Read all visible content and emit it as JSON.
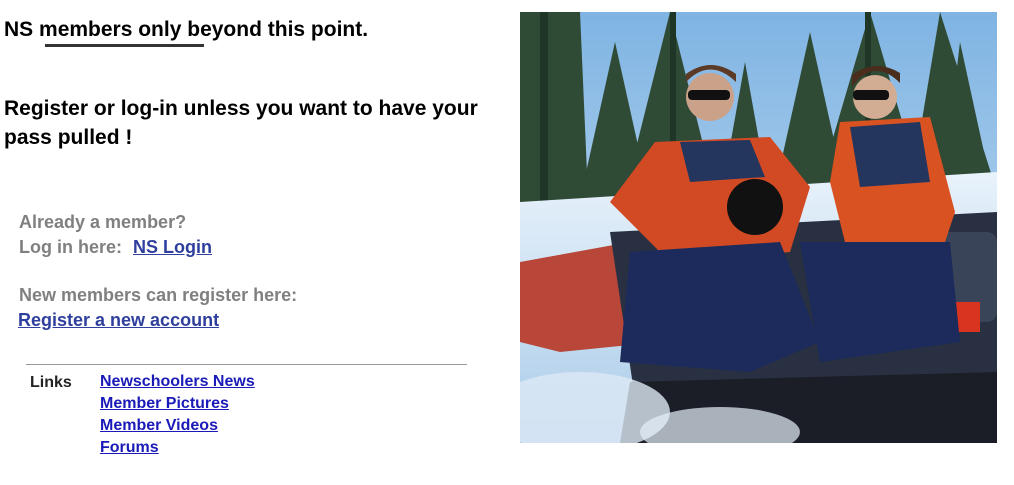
{
  "headline": {
    "prefix": "NS ",
    "emphasis": "members only",
    "suffix": " beyond this point."
  },
  "subhead": "Register or log-in unless you want to have your pass pulled !",
  "member": {
    "question": "Already a member?",
    "login_prompt": "Log in here:",
    "login_link": "NS Login"
  },
  "register": {
    "prompt": "New members can register here:",
    "link": "Register a new account"
  },
  "links": {
    "label": "Links",
    "items": [
      {
        "label": "Newschoolers News"
      },
      {
        "label": "Member Pictures"
      },
      {
        "label": "Member Videos"
      },
      {
        "label": "Forums"
      }
    ]
  },
  "photo": {
    "subject": "two people in red and navy ski jackets with sunglasses sitting on a snowmobile in snowy pine forest"
  }
}
